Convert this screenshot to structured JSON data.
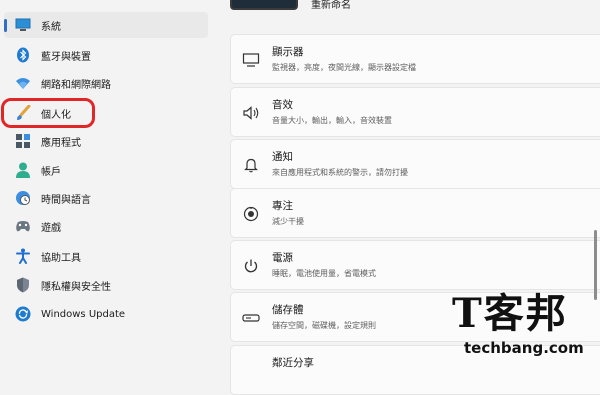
{
  "sidebar": {
    "items": [
      {
        "label": "系統",
        "icon": "monitor-icon"
      },
      {
        "label": "藍牙與裝置",
        "icon": "bluetooth-icon"
      },
      {
        "label": "網路和網際網路",
        "icon": "wifi-icon"
      },
      {
        "label": "個人化",
        "icon": "brush-icon"
      },
      {
        "label": "應用程式",
        "icon": "apps-icon"
      },
      {
        "label": "帳戶",
        "icon": "person-icon"
      },
      {
        "label": "時間與語言",
        "icon": "clock-globe-icon"
      },
      {
        "label": "遊戲",
        "icon": "gamepad-icon"
      },
      {
        "label": "協助工具",
        "icon": "accessibility-icon"
      },
      {
        "label": "隱私權與安全性",
        "icon": "shield-icon"
      },
      {
        "label": "Windows Update",
        "icon": "update-icon"
      }
    ],
    "selected_index": 0,
    "highlighted_index": 3
  },
  "header": {
    "rename_label": "重新命名"
  },
  "cards": [
    {
      "title": "顯示器",
      "subtitle": "監視器，亮度，夜間光線，顯示器設定檔",
      "icon": "display-icon"
    },
    {
      "title": "音效",
      "subtitle": "音量大小，輸出，輸入，音效裝置",
      "icon": "speaker-icon"
    },
    {
      "title": "通知",
      "subtitle": "來自應用程式和系統的警示，請勿打擾",
      "icon": "bell-icon"
    },
    {
      "title": "專注",
      "subtitle": "減少干擾",
      "icon": "focus-icon"
    },
    {
      "title": "電源",
      "subtitle": "睡眠，電池使用量，省電模式",
      "icon": "power-icon"
    },
    {
      "title": "儲存體",
      "subtitle": "儲存空間，磁碟機，設定規則",
      "icon": "storage-icon"
    },
    {
      "title": "鄰近分享",
      "subtitle": "",
      "icon": "share-icon"
    }
  ],
  "watermark": {
    "logo": "T客邦",
    "url": "techbang.com"
  },
  "colors": {
    "accent": "#2e6fc7",
    "highlight": "#e02626"
  }
}
